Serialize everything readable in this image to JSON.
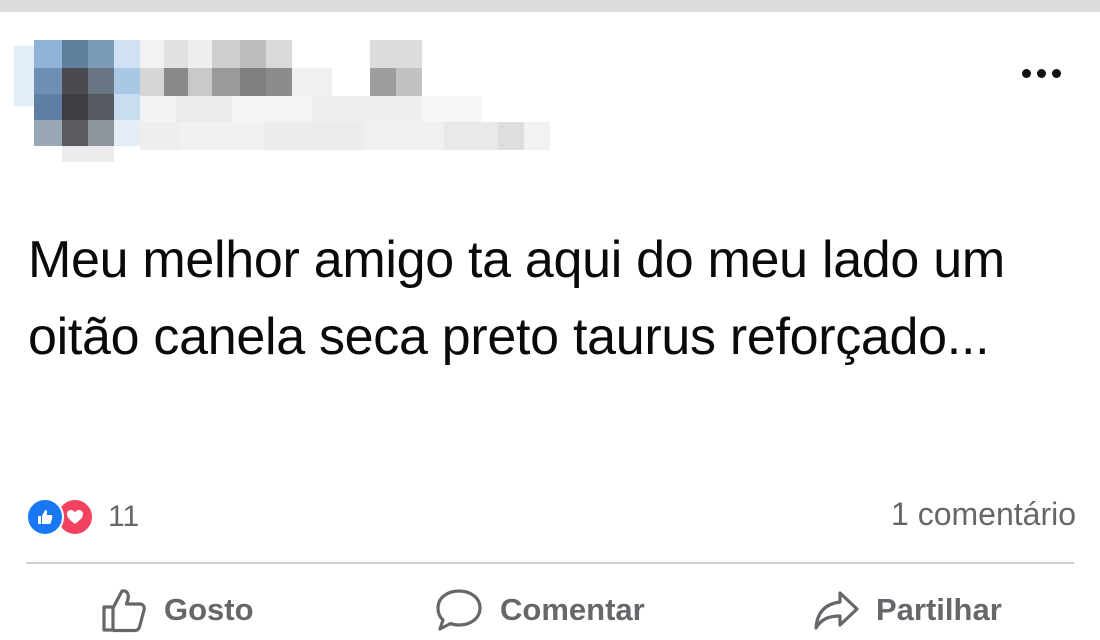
{
  "post": {
    "author_blurred": true,
    "text": "Meu melhor amigo ta aqui do meu lado um oitão canela seca preto taurus reforçado...",
    "reactions": {
      "icons": [
        "like-icon",
        "love-icon"
      ],
      "count": "11"
    },
    "comments_count": "1 comentário"
  },
  "actions": {
    "like_label": "Gosto",
    "comment_label": "Comentar",
    "share_label": "Partilhar"
  },
  "colors": {
    "like_blue": "#1877f2",
    "love_red": "#f3425f",
    "muted_text": "#65676b",
    "divider": "#ced0d4"
  }
}
